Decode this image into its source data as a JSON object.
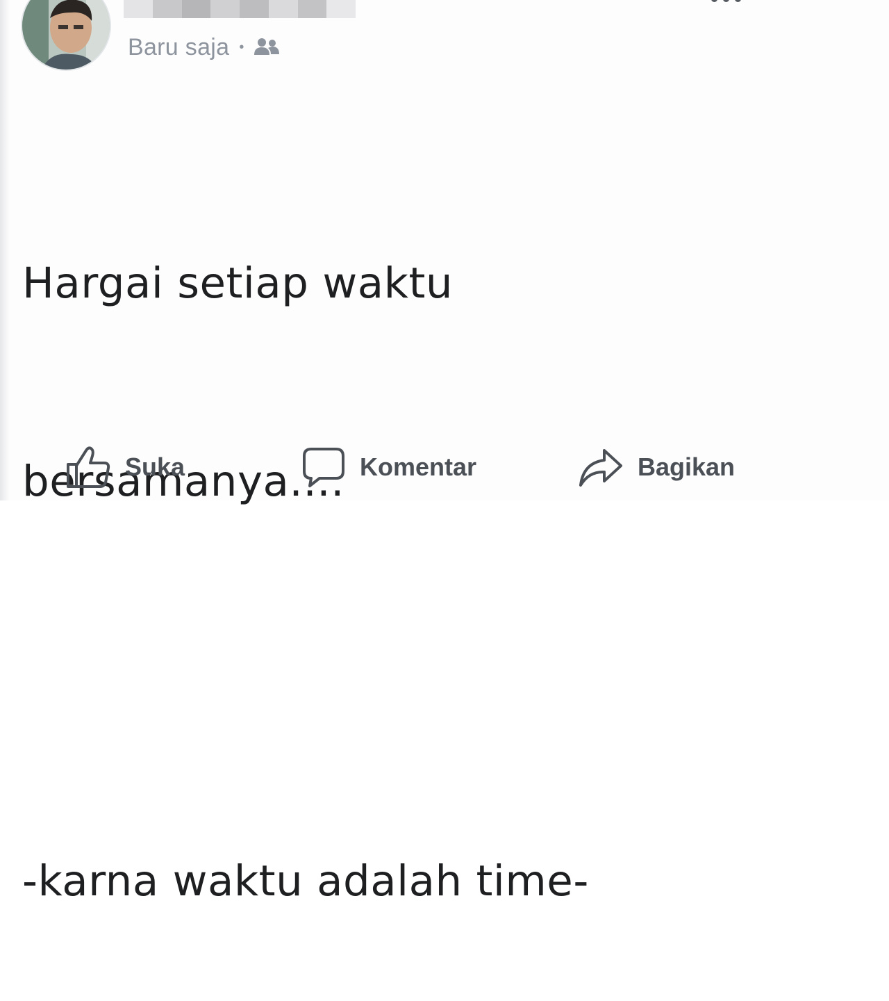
{
  "post": {
    "author_avatar_icon": "profile-photo",
    "timestamp": "Baru saja",
    "separator": "•",
    "audience_icon": "friends-icon",
    "menu_icon": "more-dots-icon",
    "text_lines": [
      "Hargai setiap waktu",
      "bersamanya....",
      "",
      "-karna waktu adalah time-"
    ]
  },
  "actions": {
    "like_label": "Suka",
    "like_icon": "thumbs-up-icon",
    "comment_label": "Komentar",
    "comment_icon": "speech-bubble-icon",
    "share_label": "Bagikan",
    "share_icon": "share-arrow-icon"
  },
  "colors": {
    "text": "#1e1f21",
    "meta": "#8d949e",
    "action_text": "#4b4f56"
  }
}
